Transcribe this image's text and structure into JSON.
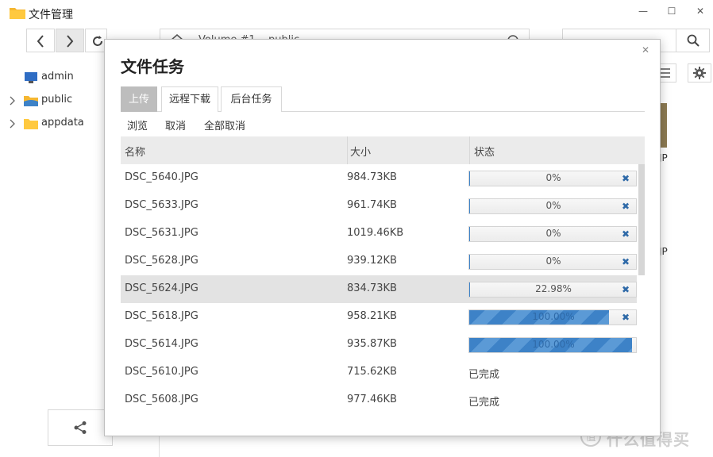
{
  "window": {
    "title": "文件管理"
  },
  "window_controls": {
    "minimize": "—",
    "maximize": "☐",
    "close": "✕"
  },
  "path": {
    "segments": [
      "Volume #1",
      "public"
    ]
  },
  "sidebar": {
    "items": [
      {
        "label": "admin",
        "icon": "computer-icon",
        "expandable": false
      },
      {
        "label": "public",
        "icon": "shared-folder-icon",
        "expandable": true
      },
      {
        "label": "appdata",
        "icon": "folder-icon",
        "expandable": true
      }
    ]
  },
  "background_labels": [
    "JP",
    "JP"
  ],
  "dialog": {
    "title": "文件任务",
    "close": "✕",
    "tabs": [
      {
        "label": "上传",
        "active": true
      },
      {
        "label": "远程下载",
        "active": false
      },
      {
        "label": "后台任务",
        "active": false
      }
    ],
    "actions": {
      "browse": "浏览",
      "cancel": "取消",
      "cancel_all": "全部取消"
    },
    "columns": {
      "name": "名称",
      "size": "大小",
      "status": "状态"
    },
    "rows": [
      {
        "name": "DSC_5640.JPG",
        "size": "984.73KB",
        "progress": 0,
        "progress_text": "0%",
        "cancel": "✖"
      },
      {
        "name": "DSC_5633.JPG",
        "size": "961.74KB",
        "progress": 0,
        "progress_text": "0%",
        "cancel": "✖"
      },
      {
        "name": "DSC_5631.JPG",
        "size": "1019.46KB",
        "progress": 0,
        "progress_text": "0%",
        "cancel": "✖"
      },
      {
        "name": "DSC_5628.JPG",
        "size": "939.12KB",
        "progress": 0,
        "progress_text": "0%",
        "cancel": "✖"
      },
      {
        "name": "DSC_5624.JPG",
        "size": "834.73KB",
        "progress": 0.2298,
        "progress_text": "22.98%",
        "cancel": "✖",
        "selected": true
      },
      {
        "name": "DSC_5618.JPG",
        "size": "958.21KB",
        "progress": 1,
        "progress_text": "100.00%",
        "cancel": "✖"
      },
      {
        "name": "DSC_5614.JPG",
        "size": "935.87KB",
        "progress": 1,
        "progress_text": "100.00%",
        "cancel": ""
      },
      {
        "name": "DSC_5610.JPG",
        "size": "715.62KB",
        "status": "已完成"
      },
      {
        "name": "DSC_5608.JPG",
        "size": "977.46KB",
        "status": "已完成"
      }
    ]
  },
  "watermark": {
    "text": "什么值得买",
    "icon": "值"
  },
  "colors": {
    "accent": "#3d82c7",
    "tab_active": "#bdbdbd"
  }
}
